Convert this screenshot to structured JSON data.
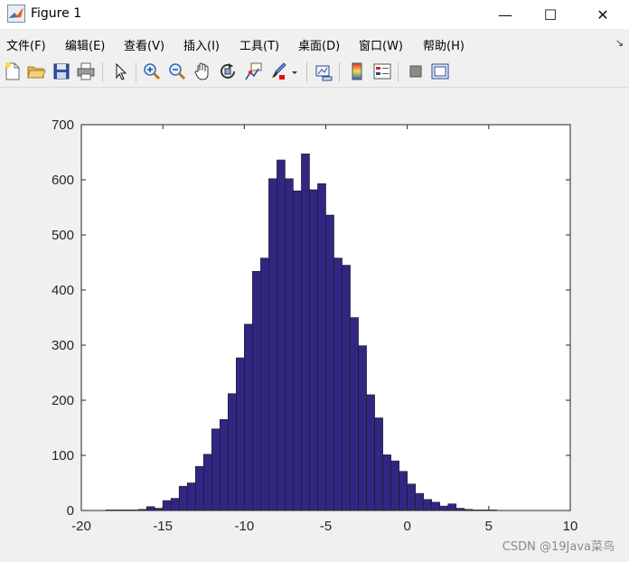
{
  "window": {
    "title": "Figure 1",
    "controls": {
      "minimize": "—",
      "maximize": "☐",
      "close": "✕"
    }
  },
  "menu": {
    "items": [
      "文件(F)",
      "编辑(E)",
      "查看(V)",
      "插入(I)",
      "工具(T)",
      "桌面(D)",
      "窗口(W)",
      "帮助(H)"
    ],
    "corner_glyph": "↘"
  },
  "toolbar": {
    "icons": [
      "new-figure-icon",
      "open-file-icon",
      "save-icon",
      "print-icon",
      "pointer-icon",
      "zoom-in-icon",
      "zoom-out-icon",
      "pan-icon",
      "rotate-3d-icon",
      "data-cursor-icon",
      "brush-icon",
      "link-plot-icon",
      "colorbar-icon",
      "legend-icon",
      "hide-plot-tools-icon",
      "show-plot-tools-icon"
    ]
  },
  "colors": {
    "bar_fill": "#312783",
    "bar_edge": "#1a1a1a",
    "axes_bg": "#ffffff",
    "figure_bg": "#f0f0f0"
  },
  "chart_data": {
    "type": "bar",
    "title": "",
    "xlabel": "",
    "ylabel": "",
    "xlim": [
      -20,
      10
    ],
    "ylim": [
      0,
      700
    ],
    "xticks": [
      -20,
      -15,
      -10,
      -5,
      0,
      5,
      10
    ],
    "yticks": [
      0,
      100,
      200,
      300,
      400,
      500,
      600,
      700
    ],
    "grid": false,
    "bin_edges_start": -18.5,
    "bin_width": 0.5,
    "values": [
      1,
      1,
      1,
      1,
      2,
      7,
      4,
      18,
      22,
      44,
      50,
      80,
      102,
      148,
      165,
      212,
      277,
      338,
      434,
      458,
      602,
      636,
      602,
      580,
      647,
      582,
      593,
      536,
      458,
      445,
      350,
      299,
      210,
      168,
      101,
      90,
      71,
      48,
      31,
      20,
      15,
      8,
      12,
      4,
      2,
      1,
      1,
      1
    ]
  },
  "watermark": "CSDN @19Java菜鸟"
}
